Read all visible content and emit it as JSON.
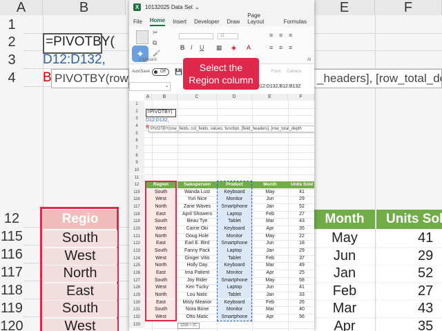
{
  "background": {
    "columns": [
      "A",
      "B",
      "E",
      "F"
    ],
    "rows": [
      "1",
      "2",
      "3",
      "4",
      "12",
      "115",
      "116",
      "117",
      "118",
      "119",
      "120"
    ],
    "formula_line1": "=PIVOTBY(",
    "formula_line2": "D12:D132,",
    "formula_line3": "B",
    "tooltip_left": "PIVOTBY(row_fi",
    "tooltip_right": "_headers], [row_total_depth",
    "header_region": "Regio",
    "header_month": "Month",
    "header_units": "Units Solo",
    "regions": [
      "South",
      "West",
      "North",
      "East",
      "South",
      "West"
    ],
    "months": [
      "May",
      "Jun",
      "Jan",
      "Feb",
      "Mar",
      "Apr"
    ],
    "units": [
      "41",
      "29",
      "52",
      "27",
      "43",
      "35"
    ]
  },
  "app": {
    "title": "10132025 Data Set",
    "title_chevron": "⌄"
  },
  "tabs": [
    "File",
    "Home",
    "Insert",
    "Developer",
    "Draw",
    "Page Layout",
    "Formulas"
  ],
  "ribbon": {
    "clipboard": "Clipboard",
    "alignment": "Al",
    "font_size": "11",
    "form": "Form",
    "camera": "Camera"
  },
  "autosave": {
    "label": "AutoSave",
    "state": "Off"
  },
  "callout": "Select the Region column",
  "formula_bar": {
    "name_box": "",
    "formula": "D12:D132,B12:B132"
  },
  "grid": {
    "columns": [
      "A",
      "B",
      "C",
      "D",
      "E",
      "F"
    ],
    "rows": [
      "1",
      "2",
      "3",
      "4",
      "5",
      "6",
      "7",
      "8",
      "9",
      "10",
      "11",
      "12",
      "115",
      "116",
      "117",
      "118",
      "119",
      "120",
      "121",
      "122",
      "123",
      "124",
      "125",
      "126",
      "127",
      "128",
      "129",
      "130",
      "131",
      "132",
      "133"
    ],
    "formula_l1": "=PIVOTBY(",
    "formula_l2": "D12:D132,",
    "formula_l3": "B",
    "arg_tip": "PIVOTBY(row_fields, col_fields, values, function, [field_headers], [row_total_depth",
    "headers": [
      "Region",
      "Salesperson",
      "Product",
      "Month",
      "Units Sold"
    ],
    "records": [
      [
        "South",
        "Wanda Lust",
        "Keyboard",
        "May",
        "41"
      ],
      [
        "West",
        "Yuri Nice",
        "Monitor",
        "Jun",
        "29"
      ],
      [
        "North",
        "Zane Waves",
        "Smartphone",
        "Jan",
        "52"
      ],
      [
        "East",
        "April Showers",
        "Laptop",
        "Feb",
        "27"
      ],
      [
        "South",
        "Beau Tye",
        "Tablet",
        "Mar",
        "43"
      ],
      [
        "West",
        "Carrie Oki",
        "Keyboard",
        "Apr",
        "35"
      ],
      [
        "North",
        "Doug Hole",
        "Monitor",
        "May",
        "22"
      ],
      [
        "East",
        "Earl E. Bird",
        "Smartphone",
        "Jun",
        "18"
      ],
      [
        "South",
        "Fanny Pack",
        "Laptop",
        "Jan",
        "29"
      ],
      [
        "West",
        "Ginger Vitis",
        "Tablet",
        "Feb",
        "37"
      ],
      [
        "North",
        "Holly Day",
        "Keyboard",
        "Mar",
        "49"
      ],
      [
        "East",
        "Ima Patient",
        "Monitor",
        "Apr",
        "25"
      ],
      [
        "South",
        "Joy Rider",
        "Smartphone",
        "May",
        "58"
      ],
      [
        "West",
        "Ken Tucky",
        "Laptop",
        "Jun",
        "41"
      ],
      [
        "North",
        "Lou Natic",
        "Tablet",
        "Jan",
        "33"
      ],
      [
        "East",
        "Misty Meanor",
        "Keyboard",
        "Feb",
        "26"
      ],
      [
        "South",
        "Nora Bone",
        "Monitor",
        "Mar",
        "40"
      ],
      [
        "West",
        "Otto Matic",
        "Smartphone",
        "Apr",
        "56"
      ]
    ],
    "count_hint": "121R × 1C"
  },
  "colors": {
    "header_green": "#70ad47",
    "region_fill": "#fde7e7",
    "region_border": "#e0284a",
    "product_fill": "#dde8f6",
    "callout": "#e0284a"
  }
}
